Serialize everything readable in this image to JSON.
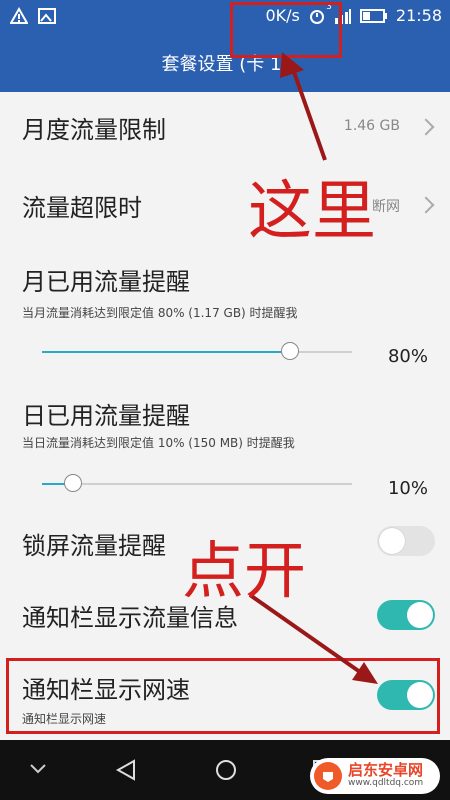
{
  "status_bar": {
    "speed": "0K/s",
    "alarm_badge": "3",
    "time": "21:58"
  },
  "app_bar": {
    "title": "套餐设置 (卡 1)"
  },
  "settings": {
    "monthly_limit": {
      "title": "月度流量限制",
      "value": "1.46 GB"
    },
    "over_limit": {
      "title": "流量超限时",
      "value": "断网"
    },
    "monthly_reminder": {
      "title": "月已用流量提醒",
      "subtitle": "当月流量消耗达到限定值 80% (1.17 GB) 时提醒我",
      "percent": "80%",
      "percent_value": 80
    },
    "daily_reminder": {
      "title": "日已用流量提醒",
      "subtitle": "当日流量消耗达到限定值 10% (150 MB) 时提醒我",
      "percent": "10%",
      "percent_value": 10
    },
    "lock_screen": {
      "title": "锁屏流量提醒",
      "enabled": false
    },
    "notif_traffic": {
      "title": "通知栏显示流量信息",
      "enabled": true
    },
    "notif_speed": {
      "title": "通知栏显示网速",
      "subtitle": "通知栏显示网速",
      "enabled": true
    }
  },
  "annotations": {
    "here": "这里",
    "turn_on": "点开",
    "color": "#d41f1f"
  },
  "watermark": {
    "name": "启东安卓网",
    "url": "www.qdltdq.com"
  },
  "colors": {
    "header": "#2b5fb0",
    "toggle_on": "#2fb8b0",
    "slider_fill": "#27a9c7"
  }
}
